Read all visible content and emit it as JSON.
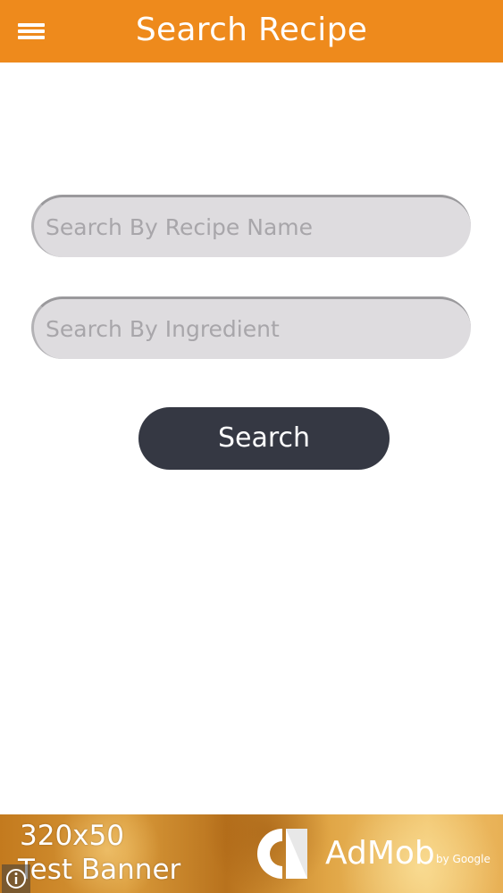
{
  "header": {
    "title": "Search Recipe",
    "menu_icon": "hamburger-menu-icon",
    "background_color": "#ee8a1c"
  },
  "search_form": {
    "recipe_name_placeholder": "Search By Recipe Name",
    "recipe_name_value": "",
    "ingredient_placeholder": "Search By Ingredient",
    "ingredient_value": "",
    "search_button_label": "Search",
    "field_color": "#dedcdf",
    "button_color": "#353843"
  },
  "ad_banner": {
    "line1": "320x50",
    "line2": "Test Banner",
    "brand": "AdMob",
    "brand_suffix": "by Google",
    "info_icon": "info-icon"
  }
}
